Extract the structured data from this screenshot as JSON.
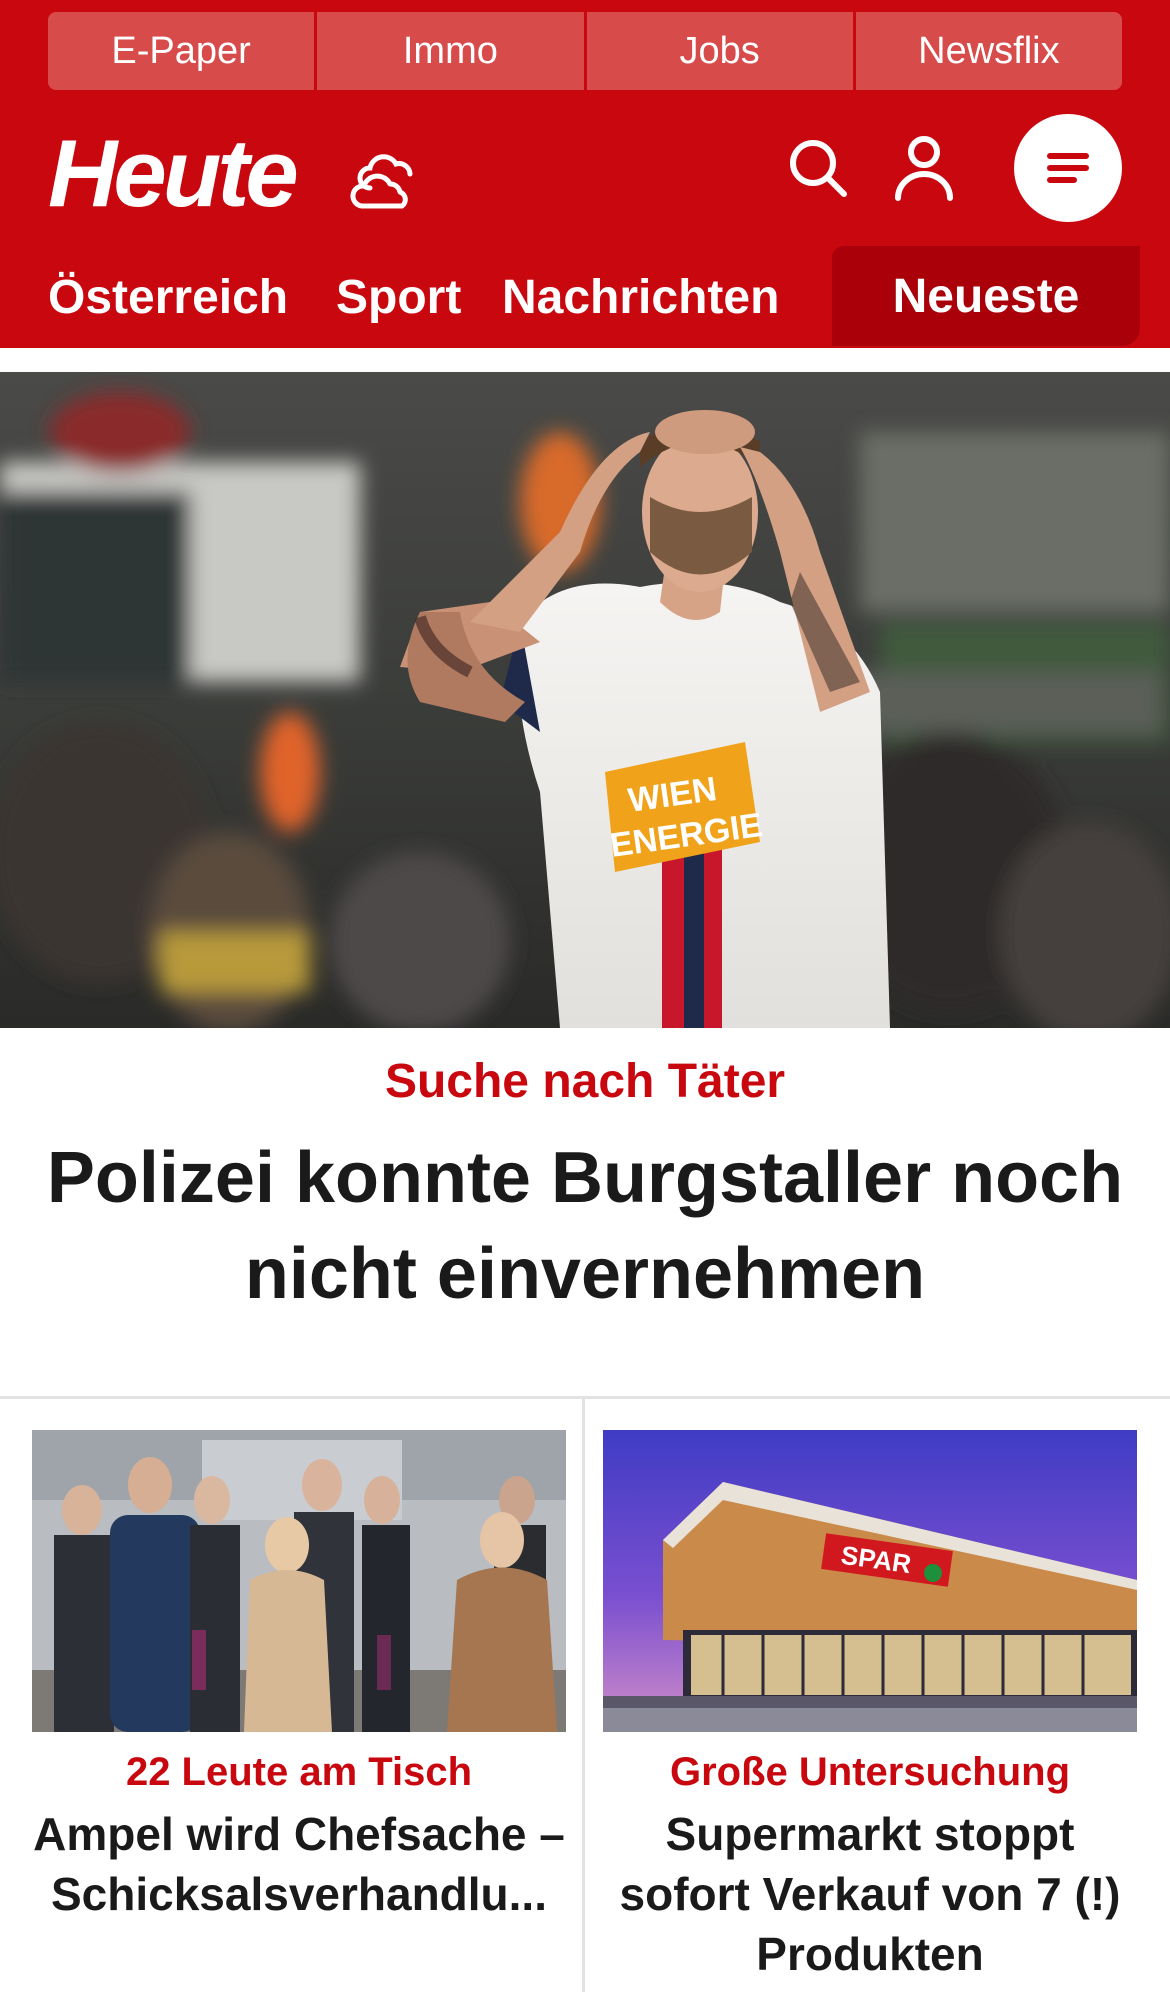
{
  "colors": {
    "brand_red": "#c8070f",
    "brand_red_dark": "#a90009",
    "topnav_red": "#d84b4b",
    "text_dark": "#1a1a1a"
  },
  "topnav": [
    "E-Paper",
    "Immo",
    "Jobs",
    "Newsflix"
  ],
  "header": {
    "logo": "Heute",
    "icons": [
      "weather-cloud-icon",
      "search-icon",
      "user-icon",
      "menu-icon"
    ]
  },
  "sections": {
    "items": [
      "Österreich",
      "Sport",
      "Nachrichten"
    ],
    "active": "Neueste"
  },
  "hero": {
    "image": "football-player-hands-on-head",
    "kicker": "Suche nach Täter",
    "title": "Polizei konnte Burgstaller noch nicht einvernehmen"
  },
  "cards": [
    {
      "image": "politicians-walking-group",
      "kicker": "22 Leute am Tisch",
      "title": "Ampel wird Chefsache – Schicksalsverhandlu..."
    },
    {
      "image": "spar-supermarket-building",
      "kicker": "Große Untersuchung",
      "title": "Supermarkt stoppt sofort Verkauf von 7 (!) Produkten"
    }
  ]
}
